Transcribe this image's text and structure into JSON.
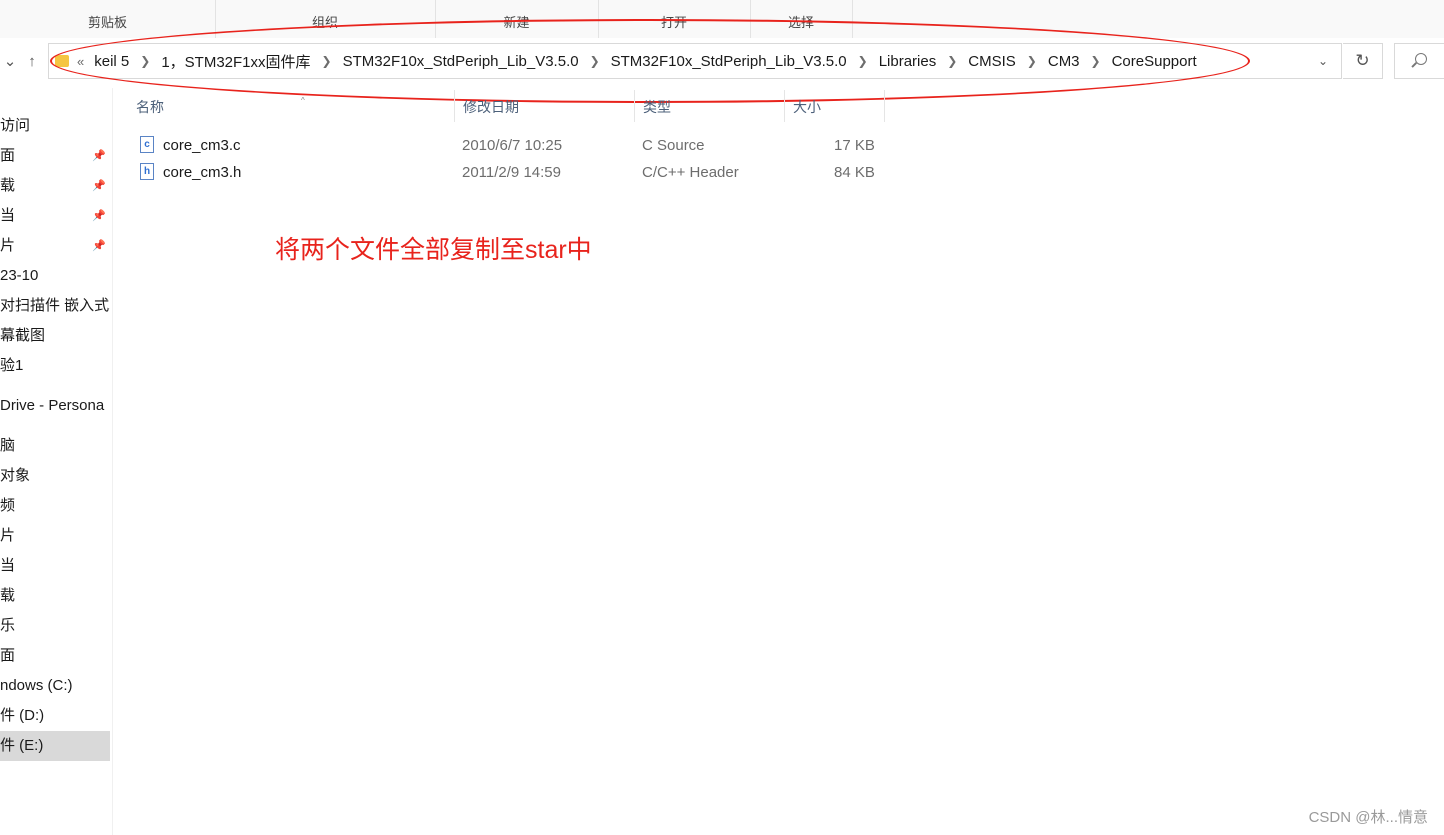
{
  "ribbon": {
    "groups": [
      "剪贴板",
      "组织",
      "新建",
      "打开",
      "选择"
    ]
  },
  "address_bar": {
    "overflow": "«",
    "crumbs": [
      "keil 5",
      "1，STM32F1xx固件库",
      "STM32F10x_StdPeriph_Lib_V3.5.0",
      "STM32F10x_StdPeriph_Lib_V3.5.0",
      "Libraries",
      "CMSIS",
      "CM3",
      "CoreSupport"
    ],
    "dropdown_icon": "chevron-down-icon",
    "refresh_icon": "refresh-icon",
    "search_icon": "search-icon",
    "annotation_color": "#e8231c"
  },
  "sidebar": {
    "items": [
      {
        "label": "访问",
        "pinned": false
      },
      {
        "label": "面",
        "pinned": true
      },
      {
        "label": "载",
        "pinned": true
      },
      {
        "label": "当",
        "pinned": true
      },
      {
        "label": "片",
        "pinned": true
      },
      {
        "label": "23-10",
        "pinned": false
      },
      {
        "label": "对扫描件 嵌入式单",
        "pinned": false
      },
      {
        "label": "幕截图",
        "pinned": false
      },
      {
        "label": "验1",
        "pinned": false
      },
      {
        "label": "Drive - Persona",
        "pinned": false
      },
      {
        "label": "脑",
        "pinned": false
      },
      {
        "label": " 对象",
        "pinned": false
      },
      {
        "label": "频",
        "pinned": false
      },
      {
        "label": "片",
        "pinned": false
      },
      {
        "label": "当",
        "pinned": false
      },
      {
        "label": "载",
        "pinned": false
      },
      {
        "label": "乐",
        "pinned": false
      },
      {
        "label": "面",
        "pinned": false
      },
      {
        "label": "ndows (C:)",
        "pinned": false
      },
      {
        "label": "件 (D:)",
        "pinned": false
      },
      {
        "label": "件 (E:)",
        "pinned": false,
        "selected": true
      }
    ]
  },
  "file_list": {
    "columns": [
      "名称",
      "修改日期",
      "类型",
      "大小"
    ],
    "rows": [
      {
        "name": "core_cm3.c",
        "icon": "c-source-file-icon",
        "icon_letter": "c",
        "modified": "2010/6/7 10:25",
        "type": "C Source",
        "size": "17 KB"
      },
      {
        "name": "core_cm3.h",
        "icon": "header-file-icon",
        "icon_letter": "h",
        "modified": "2011/2/9 14:59",
        "type": "C/C++ Header",
        "size": "84 KB"
      }
    ]
  },
  "annotation": "将两个文件全部复制至star中",
  "watermark": "CSDN @林...情意"
}
